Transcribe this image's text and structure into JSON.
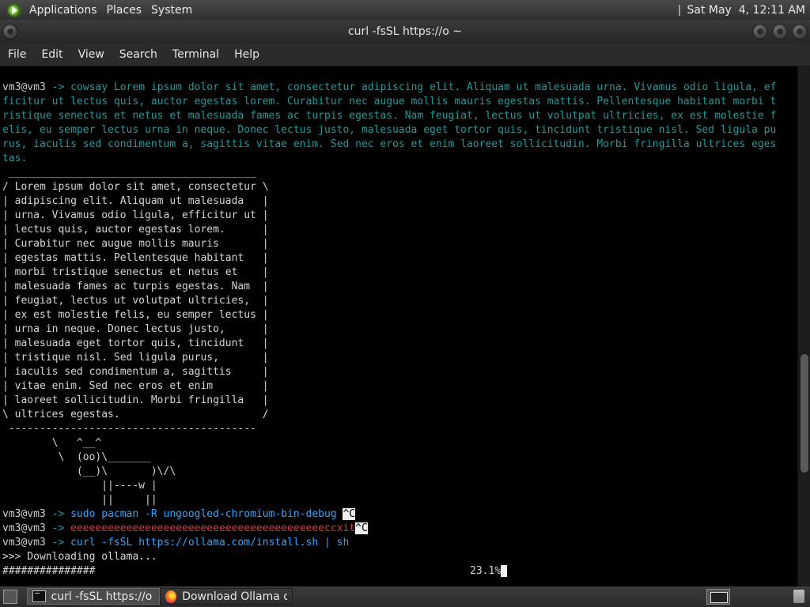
{
  "top_panel": {
    "menus": [
      "Applications",
      "Places",
      "System"
    ],
    "clock": "Sat May  4, 12:11 AM"
  },
  "window": {
    "title": "curl -fsSL https://o ~"
  },
  "menubar": [
    "File",
    "Edit",
    "View",
    "Search",
    "Terminal",
    "Help"
  ],
  "terminal": {
    "prompt": "vm3@vm3",
    "arrow": "->",
    "cowsay_cmd": "cowsay",
    "cowsay_text": [
      " Lorem ipsum dolor sit amet, consectetur adipiscing elit. Aliquam ut malesuada urna. Vivamus odio ligula, ef",
      "ficitur ut lectus quis, auctor egestas lorem. Curabitur nec augue mollis mauris egestas mattis. Pellentesque habitant morbi t",
      "ristique senectus et netus et malesuada fames ac turpis egestas. Nam feugiat, lectus ut volutpat ultricies, ex est molestie f",
      "elis, eu semper lectus urna in neque. Donec lectus justo, malesuada eget tortor quis, tincidunt tristique nisl. Sed ligula pu",
      "rus, iaculis sed condimentum a, sagittis vitae enim. Sed nec eros et enim laoreet sollicitudin. Morbi fringilla ultrices eges",
      "tas."
    ],
    "cowsay_art": " ________________________________________\n/ Lorem ipsum dolor sit amet, consectetur \\\n| adipiscing elit. Aliquam ut malesuada   |\n| urna. Vivamus odio ligula, efficitur ut |\n| lectus quis, auctor egestas lorem.      |\n| Curabitur nec augue mollis mauris       |\n| egestas mattis. Pellentesque habitant   |\n| morbi tristique senectus et netus et    |\n| malesuada fames ac turpis egestas. Nam  |\n| feugiat, lectus ut volutpat ultricies,  |\n| ex est molestie felis, eu semper lectus |\n| urna in neque. Donec lectus justo,      |\n| malesuada eget tortor quis, tincidunt   |\n| tristique nisl. Sed ligula purus,       |\n| iaculis sed condimentum a, sagittis     |\n| vitae enim. Sed nec eros et enim        |\n| laoreet sollicitudin. Morbi fringilla   |\n\\ ultrices egestas.                       /\n ----------------------------------------\n        \\   ^__^\n         \\  (oo)\\_______\n            (__)\\       )\\/\\\n                ||----w |\n                ||     ||",
    "cmd1": "sudo pacman -R ungoogled-chromium-bin-debug ",
    "interrupt": "^C",
    "cmd2": "eeeeeeeeeeeeeeeeeeeeeeeeeeeeeeeeeeeeeeeeeccxit",
    "cmd3": "curl -fsSL https://ollama.com/install.sh | sh",
    "download_msg": ">>> Downloading ollama...",
    "progress_hashes": "###############",
    "progress_percent": "23.1%",
    "progress_value": 23.1
  },
  "scrollbar": {
    "position_fraction": 0.72
  },
  "bottom_panel": {
    "tasks": [
      "curl -fsSL https://o ~",
      "Download Ollama o..."
    ]
  }
}
